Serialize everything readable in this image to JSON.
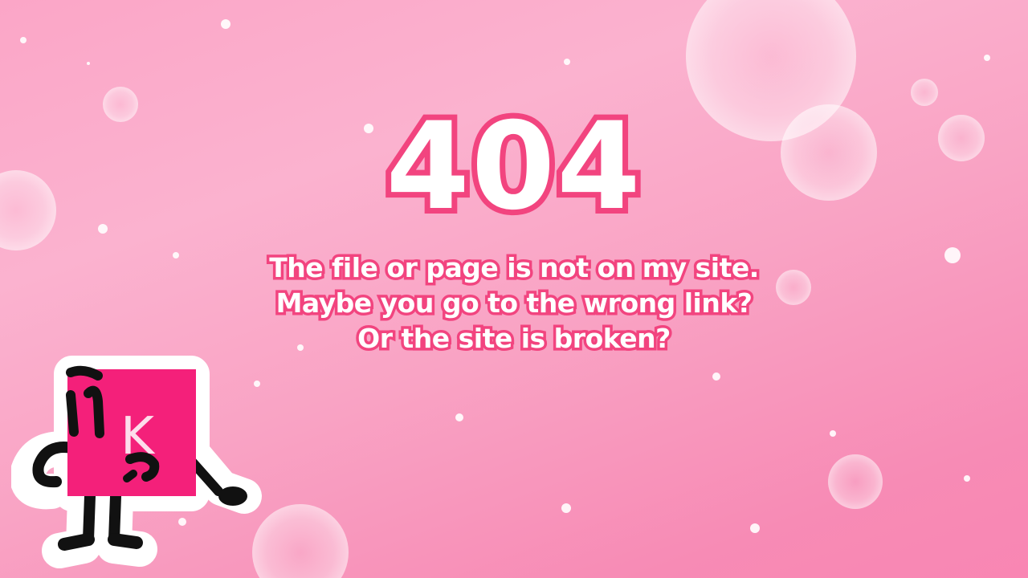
{
  "error_page": {
    "code": "404",
    "message_lines": [
      "The file or page is not on my site.",
      "Maybe you go to the wrong link?",
      "Or the site is broken?"
    ]
  },
  "mascot": {
    "icon": "sad-square-mascot-icon",
    "letter": "K"
  },
  "colors": {
    "accent": "#f2447f",
    "mascot_fill": "#f4207a",
    "background_light": "#fbb2cf",
    "background_dark": "#f986b3"
  }
}
